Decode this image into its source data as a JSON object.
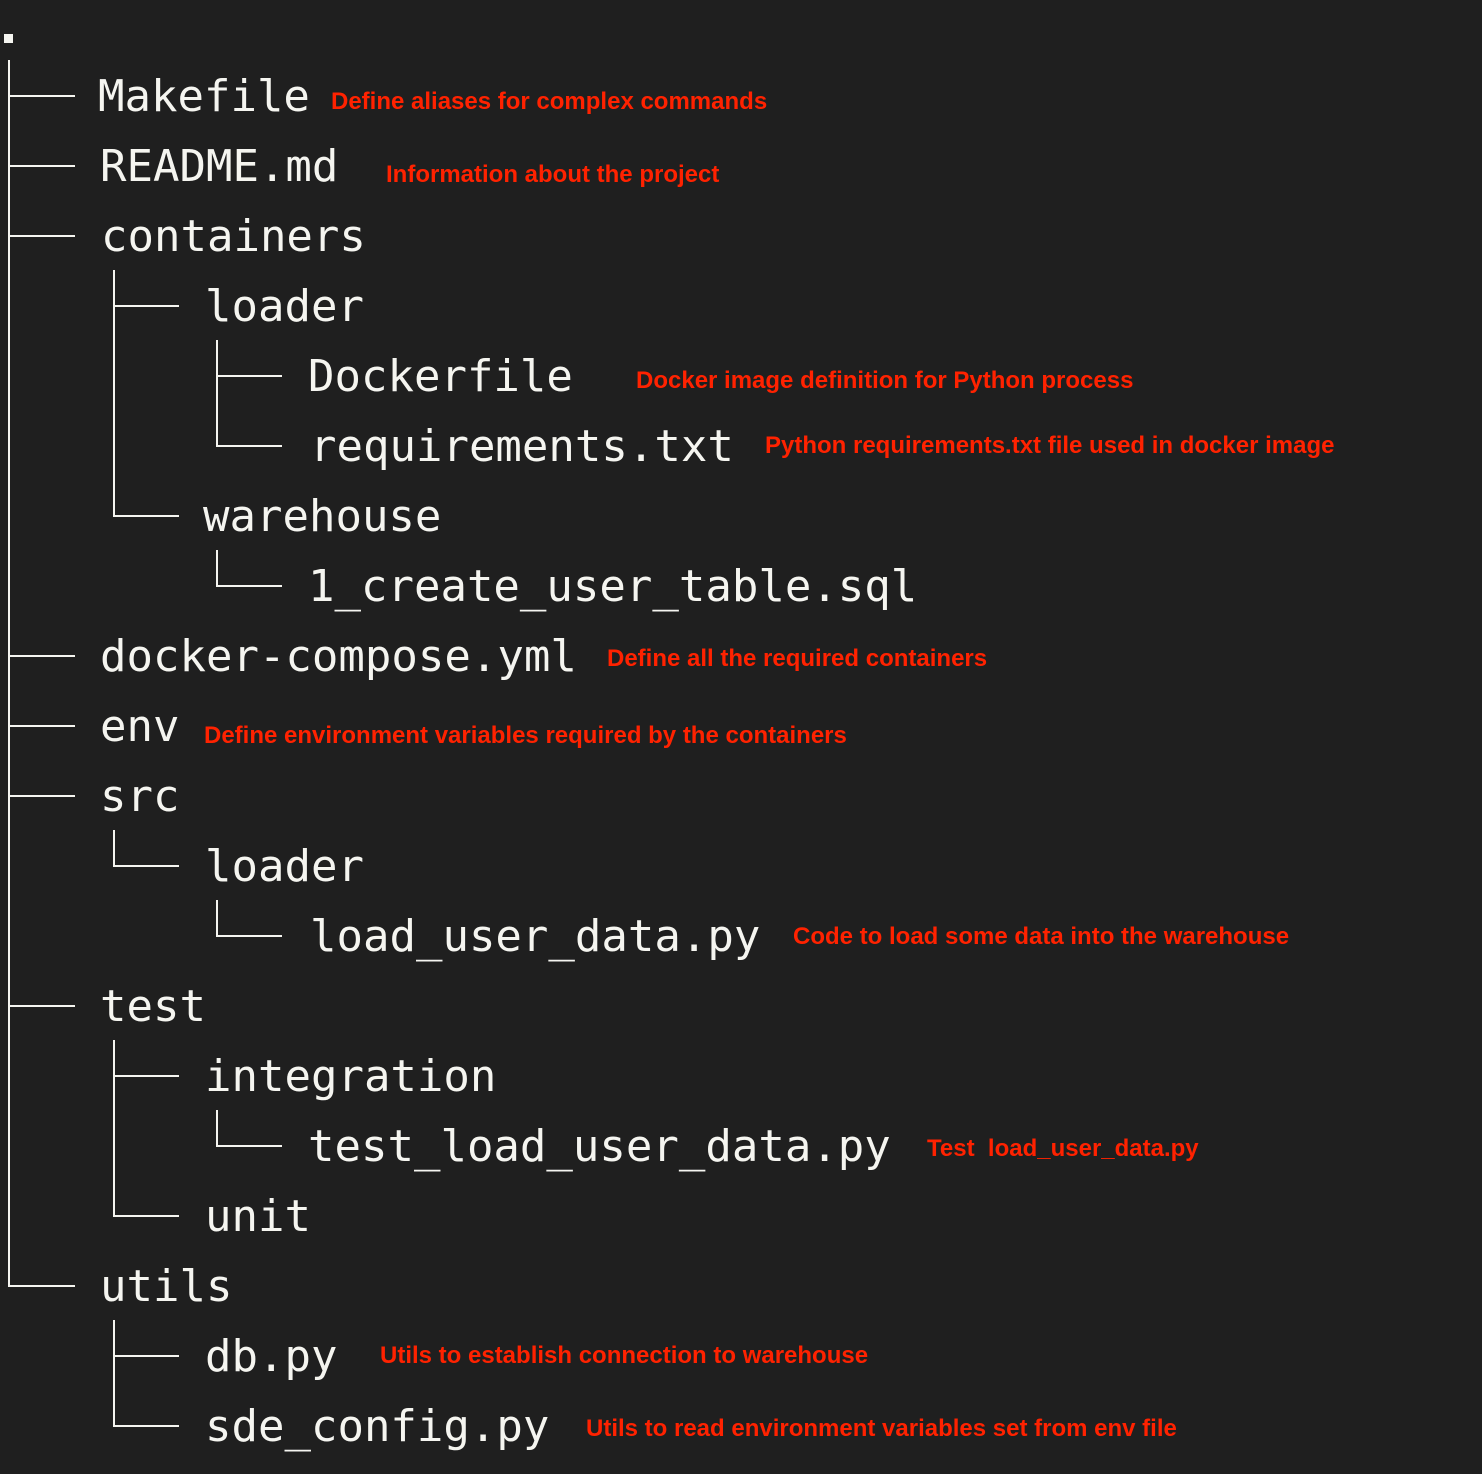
{
  "tree": {
    "root": ".",
    "colors": {
      "background": "#1f1f1f",
      "text": "#f5f5f0",
      "annotation": "#ff2200"
    },
    "entries": [
      {
        "name": "Makefile",
        "annotation": "Define aliases for complex commands"
      },
      {
        "name": "README.md",
        "annotation": "Information about the project"
      },
      {
        "name": "containers"
      },
      {
        "name": "loader"
      },
      {
        "name": "Dockerfile",
        "annotation": "Docker image definition for Python process"
      },
      {
        "name": "requirements.txt",
        "annotation": "Python requirements.txt file used in docker image"
      },
      {
        "name": "warehouse"
      },
      {
        "name": "1_create_user_table.sql"
      },
      {
        "name": "docker-compose.yml",
        "annotation": "Define all the required containers"
      },
      {
        "name": "env",
        "annotation": "Define environment variables required by the containers"
      },
      {
        "name": "src"
      },
      {
        "name": "loader"
      },
      {
        "name": "load_user_data.py",
        "annotation": "Code to load some data into the warehouse"
      },
      {
        "name": "test"
      },
      {
        "name": "integration"
      },
      {
        "name": "test_load_user_data.py",
        "annotation": "Test  load_user_data.py"
      },
      {
        "name": "unit"
      },
      {
        "name": "utils"
      },
      {
        "name": "db.py",
        "annotation": "Utils to establish connection to warehouse"
      },
      {
        "name": "sde_config.py",
        "annotation": "Utils to read environment variables set from env file"
      }
    ]
  }
}
